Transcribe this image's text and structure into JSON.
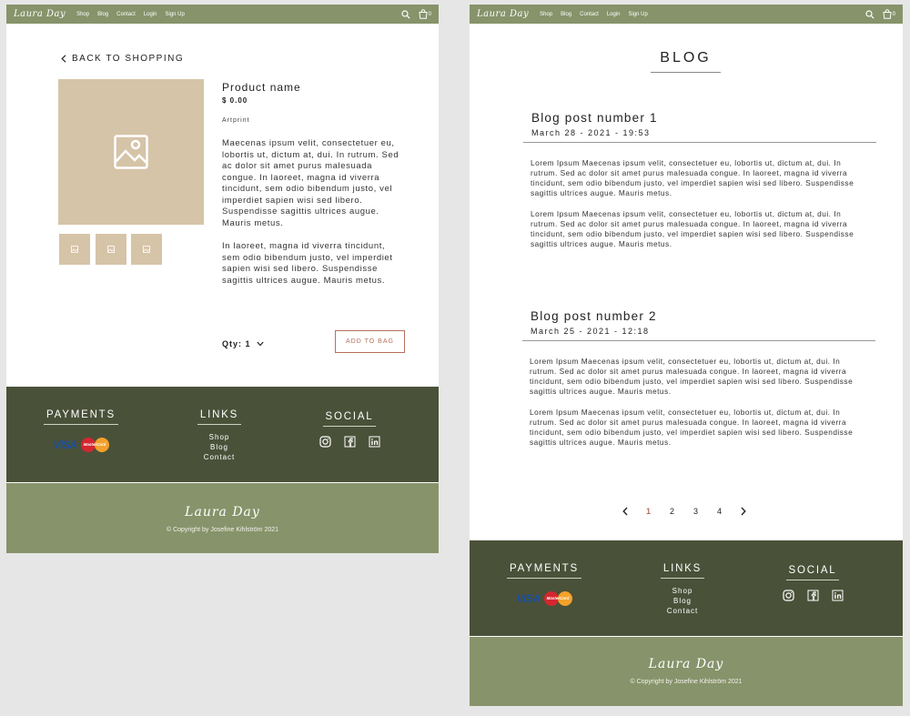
{
  "brand": "Laura Day",
  "nav": {
    "links": [
      "Shop",
      "Blog",
      "Contact",
      "Login",
      "Sign Up"
    ],
    "cart_count": "0",
    "icons": [
      "search-icon",
      "bag-icon"
    ]
  },
  "product_page": {
    "back_link": "BACK TO SHOPPING",
    "product_name": "Product name",
    "price": "$ 0.00",
    "type": "Artprint",
    "description": [
      "Maecenas ipsum velit, consectetuer eu, lobortis ut, dictum at, dui. In rutrum. Sed ac dolor sit amet purus malesuada congue. In laoreet, magna id viverra tincidunt, sem odio bibendum justo, vel imperdiet sapien wisi sed libero. Suspendisse sagittis ultrices augue. Mauris metus.",
      "In laoreet, magna id viverra tincidunt, sem odio bibendum justo, vel imperdiet sapien wisi sed libero. Suspendisse sagittis ultrices augue. Mauris metus."
    ],
    "qty_label": "Qty: 1",
    "add_button": "ADD TO BAG",
    "image_color": "#d6c4a8"
  },
  "blog_page": {
    "title": "BLOG",
    "posts": [
      {
        "title": "Blog post number 1",
        "date": "March 28 - 2021 - 19:53",
        "paragraphs": [
          "Lorem Ipsum Maecenas ipsum velit, consectetuer eu, lobortis ut, dictum at, dui. In rutrum. Sed ac dolor sit amet purus malesuada congue. In laoreet, magna id viverra tincidunt, sem odio bibendum justo, vel imperdiet sapien wisi sed libero. Suspendisse sagittis ultrices augue. Mauris metus.",
          "Lorem Ipsum Maecenas ipsum velit, consectetuer eu, lobortis ut, dictum at, dui. In rutrum. Sed ac dolor sit amet purus malesuada congue. In laoreet, magna id viverra tincidunt, sem odio bibendum justo, vel imperdiet sapien wisi sed libero. Suspendisse sagittis ultrices augue. Mauris metus."
        ]
      },
      {
        "title": "Blog post number 2",
        "date": "March 25 - 2021 - 12:18",
        "paragraphs": [
          "Lorem Ipsum Maecenas ipsum velit, consectetuer eu, lobortis ut, dictum at, dui. In rutrum. Sed ac dolor sit amet purus malesuada congue. In laoreet, magna id viverra tincidunt, sem odio bibendum justo, vel imperdiet sapien wisi sed libero. Suspendisse sagittis ultrices augue. Mauris metus.",
          "Lorem Ipsum Maecenas ipsum velit, consectetuer eu, lobortis ut, dictum at, dui. In rutrum. Sed ac dolor sit amet purus malesuada congue. In laoreet, magna id viverra tincidunt, sem odio bibendum justo, vel imperdiet sapien wisi sed libero. Suspendisse sagittis ultrices augue. Mauris metus."
        ]
      }
    ],
    "pagination": {
      "pages": [
        "1",
        "2",
        "3",
        "4"
      ],
      "current": "1"
    }
  },
  "footer": {
    "payments_heading": "PAYMENTS",
    "links_heading": "LINKS",
    "social_heading": "SOCIAL",
    "links": [
      "Shop",
      "Blog",
      "Contact"
    ],
    "cards": {
      "visa": "VISA",
      "mastercard": "MasterCard"
    },
    "social_icons": [
      "instagram-icon",
      "facebook-icon",
      "linkedin-icon"
    ],
    "brand": "Laura Day",
    "copyright": "© Copyright by Josefine Kihlström 2021"
  },
  "colors": {
    "nav_green": "#87936a",
    "footer_dark": "#4a5139",
    "accent": "#b8705a",
    "beige": "#d6c4a8"
  }
}
